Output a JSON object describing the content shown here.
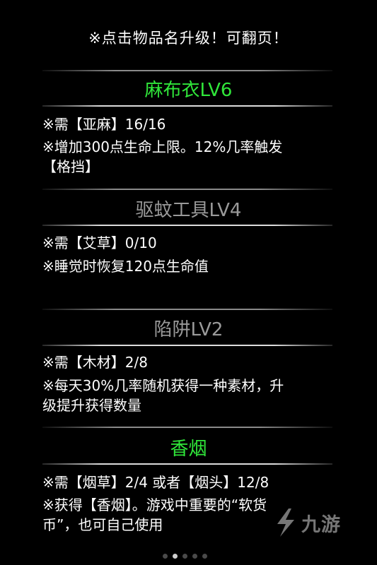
{
  "hint": "※点击物品名升级！可翻页！",
  "items": [
    {
      "name": "麻布衣LV6",
      "name_color": "#30e63a",
      "req": "※需【亚麻】16/16",
      "desc1": "※增加300点生命上限。12%几率触发",
      "desc2": "【格挡】"
    },
    {
      "name": "驱蚊工具LV4",
      "name_color": "#9a9a9a",
      "req": "※需【艾草】0/10",
      "desc1": "※睡觉时恢复120点生命值",
      "desc2": ""
    },
    {
      "name": "陷阱LV2",
      "name_color": "#9a9a9a",
      "req": "※需【木材】2/8",
      "desc1": "※每天30%几率随机获得一种素材，升",
      "desc2": "级提升获得数量"
    },
    {
      "name": "香烟",
      "name_color": "#30e63a",
      "req": "※需【烟草】2/4 或者【烟头】12/8",
      "desc1": "※获得【香烟】。游戏中重要的“软货",
      "desc2": "币”，也可自己使用"
    }
  ],
  "pager": {
    "pages": 5,
    "active": 2
  },
  "watermark": {
    "text": "九游",
    "icon": "jiuyou-logo-icon"
  }
}
